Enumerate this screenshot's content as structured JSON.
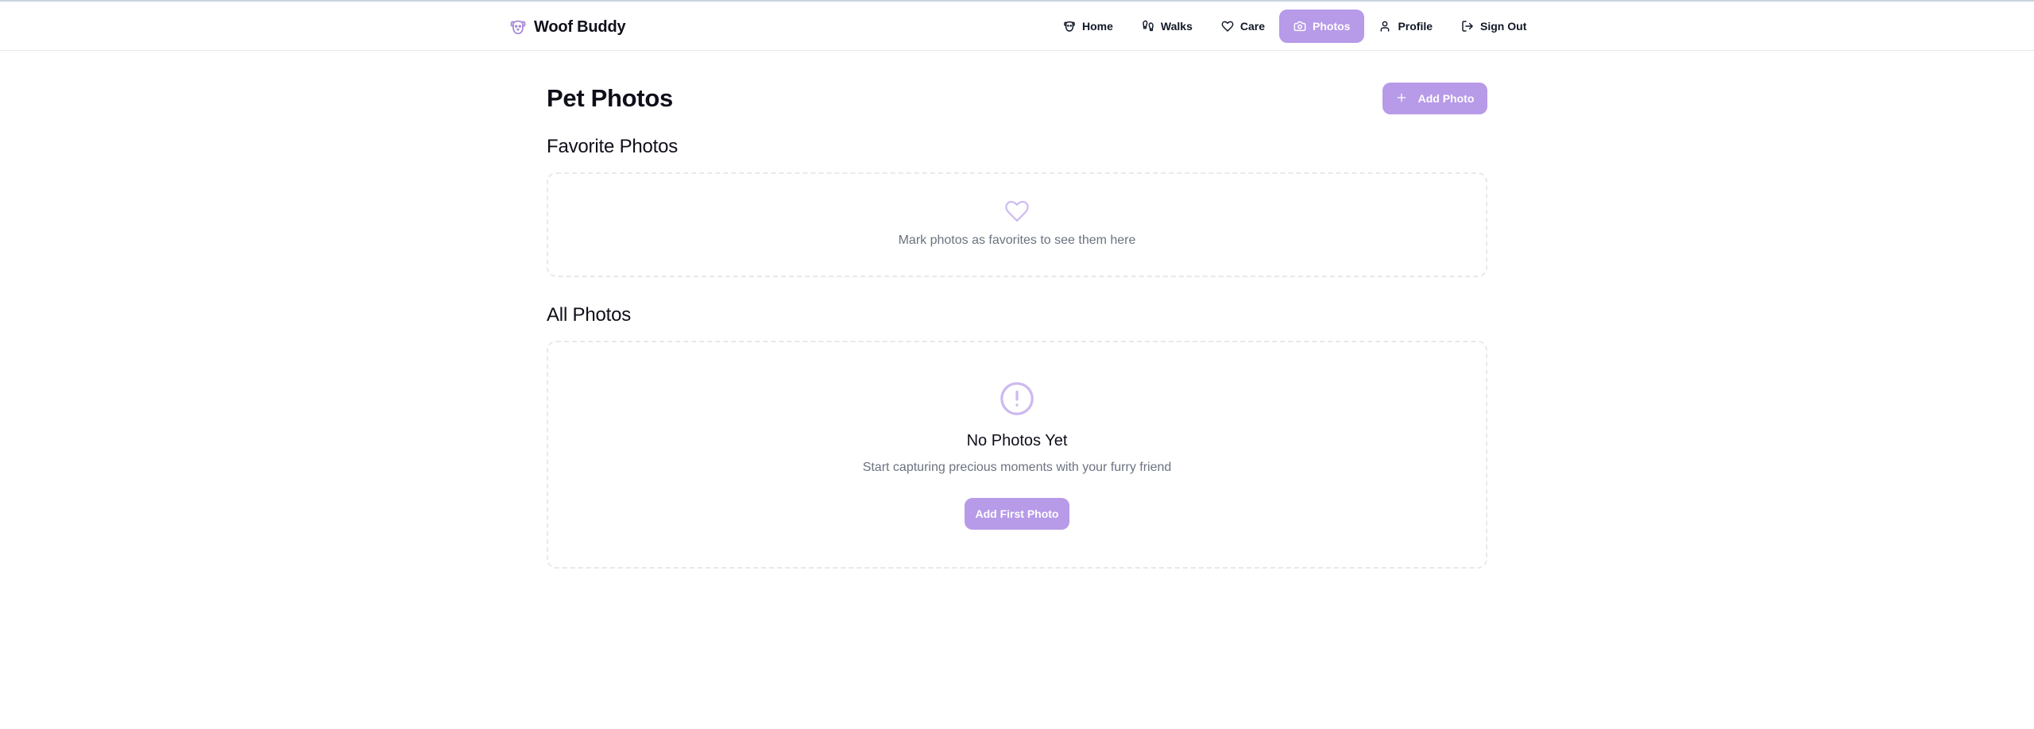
{
  "app": {
    "name": "Woof Buddy",
    "logo_icon": "dog-face-icon",
    "accent_color": "#b79ae8"
  },
  "nav": {
    "items": [
      {
        "label": "Home",
        "icon": "dog-face-icon",
        "active": false
      },
      {
        "label": "Walks",
        "icon": "footprints-icon",
        "active": false
      },
      {
        "label": "Care",
        "icon": "heart-icon",
        "active": false
      },
      {
        "label": "Photos",
        "icon": "camera-icon",
        "active": true
      },
      {
        "label": "Profile",
        "icon": "user-icon",
        "active": false
      },
      {
        "label": "Sign Out",
        "icon": "log-out-icon",
        "active": false
      }
    ]
  },
  "page": {
    "title": "Pet Photos",
    "add_button_label": "Add Photo"
  },
  "favorites": {
    "title": "Favorite Photos",
    "empty_icon": "heart-icon",
    "empty_text": "Mark photos as favorites to see them here"
  },
  "all_photos": {
    "title": "All Photos",
    "empty_icon": "alert-circle-icon",
    "empty_title": "No Photos Yet",
    "empty_subtitle": "Start capturing precious moments with your furry friend",
    "cta_label": "Add First Photo"
  }
}
